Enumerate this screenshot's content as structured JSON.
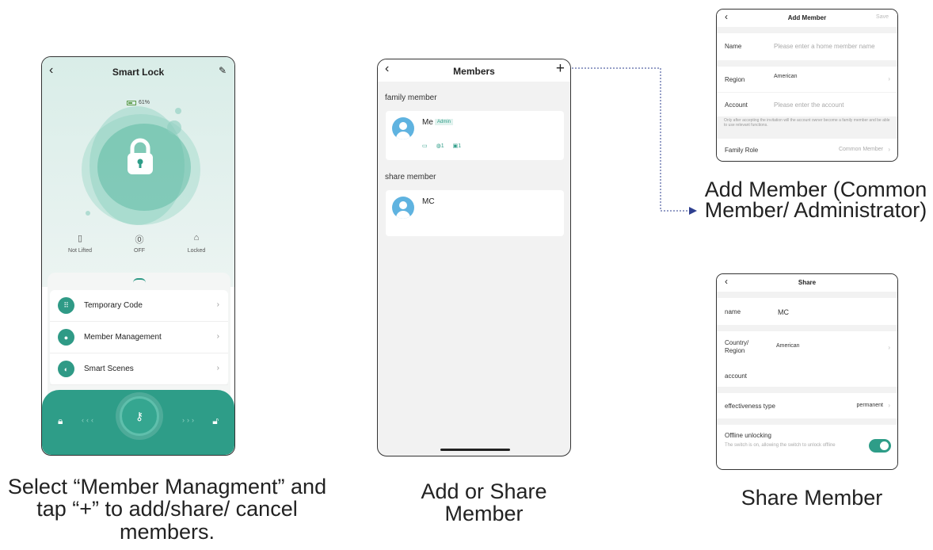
{
  "smart_lock": {
    "title": "Smart Lock",
    "battery": "61%",
    "status": [
      {
        "label": "Not Lifted",
        "icon": "door-sensor-icon"
      },
      {
        "label": "OFF",
        "icon": "alarm-icon"
      },
      {
        "label": "Locked",
        "icon": "lock-state-icon"
      }
    ],
    "menu": [
      {
        "label": "Temporary Code",
        "icon": "keypad-icon"
      },
      {
        "label": "Member Management",
        "icon": "person-icon"
      },
      {
        "label": "Smart Scenes",
        "icon": "toggle-icon"
      }
    ],
    "colors": {
      "accent": "#2e9d88",
      "bg": "#e3f0ed"
    }
  },
  "members": {
    "title": "Members",
    "family_section": "family member",
    "share_section": "share member",
    "family": [
      {
        "name": "Me",
        "badge": "Admin",
        "cred_1": "1",
        "cred_2": "1"
      }
    ],
    "share": [
      {
        "name": "MC"
      }
    ]
  },
  "add_member": {
    "title": "Add Member",
    "save": "Save",
    "name_label": "Name",
    "name_placeholder": "Please enter a home member name",
    "region_label": "Region",
    "region_value": "American",
    "account_label": "Account",
    "account_placeholder": "Please enter the account",
    "note": "Only after accepting the invitation will the account owner become a family member and be able to use relevant functions.",
    "role_label": "Family Role",
    "role_value": "Common Member"
  },
  "share": {
    "title": "Share",
    "name_label": "name",
    "name_value": "MC",
    "region_label": "Country/ Region",
    "region_value": "American",
    "account_label": "account",
    "type_label": "effectiveness type",
    "type_value": "permanent",
    "offline_label": "Offline unlocking",
    "offline_desc": "The switch is on, allowing the switch to unlock offline",
    "offline_on": true
  },
  "captions": {
    "smart_lock": "Select “Member Managment” and tap “+” to add/share/ cancel members.",
    "members": "Add or Share Member",
    "add_member": "Add Member (Common Member/ Administrator)",
    "share": "Share Member"
  }
}
